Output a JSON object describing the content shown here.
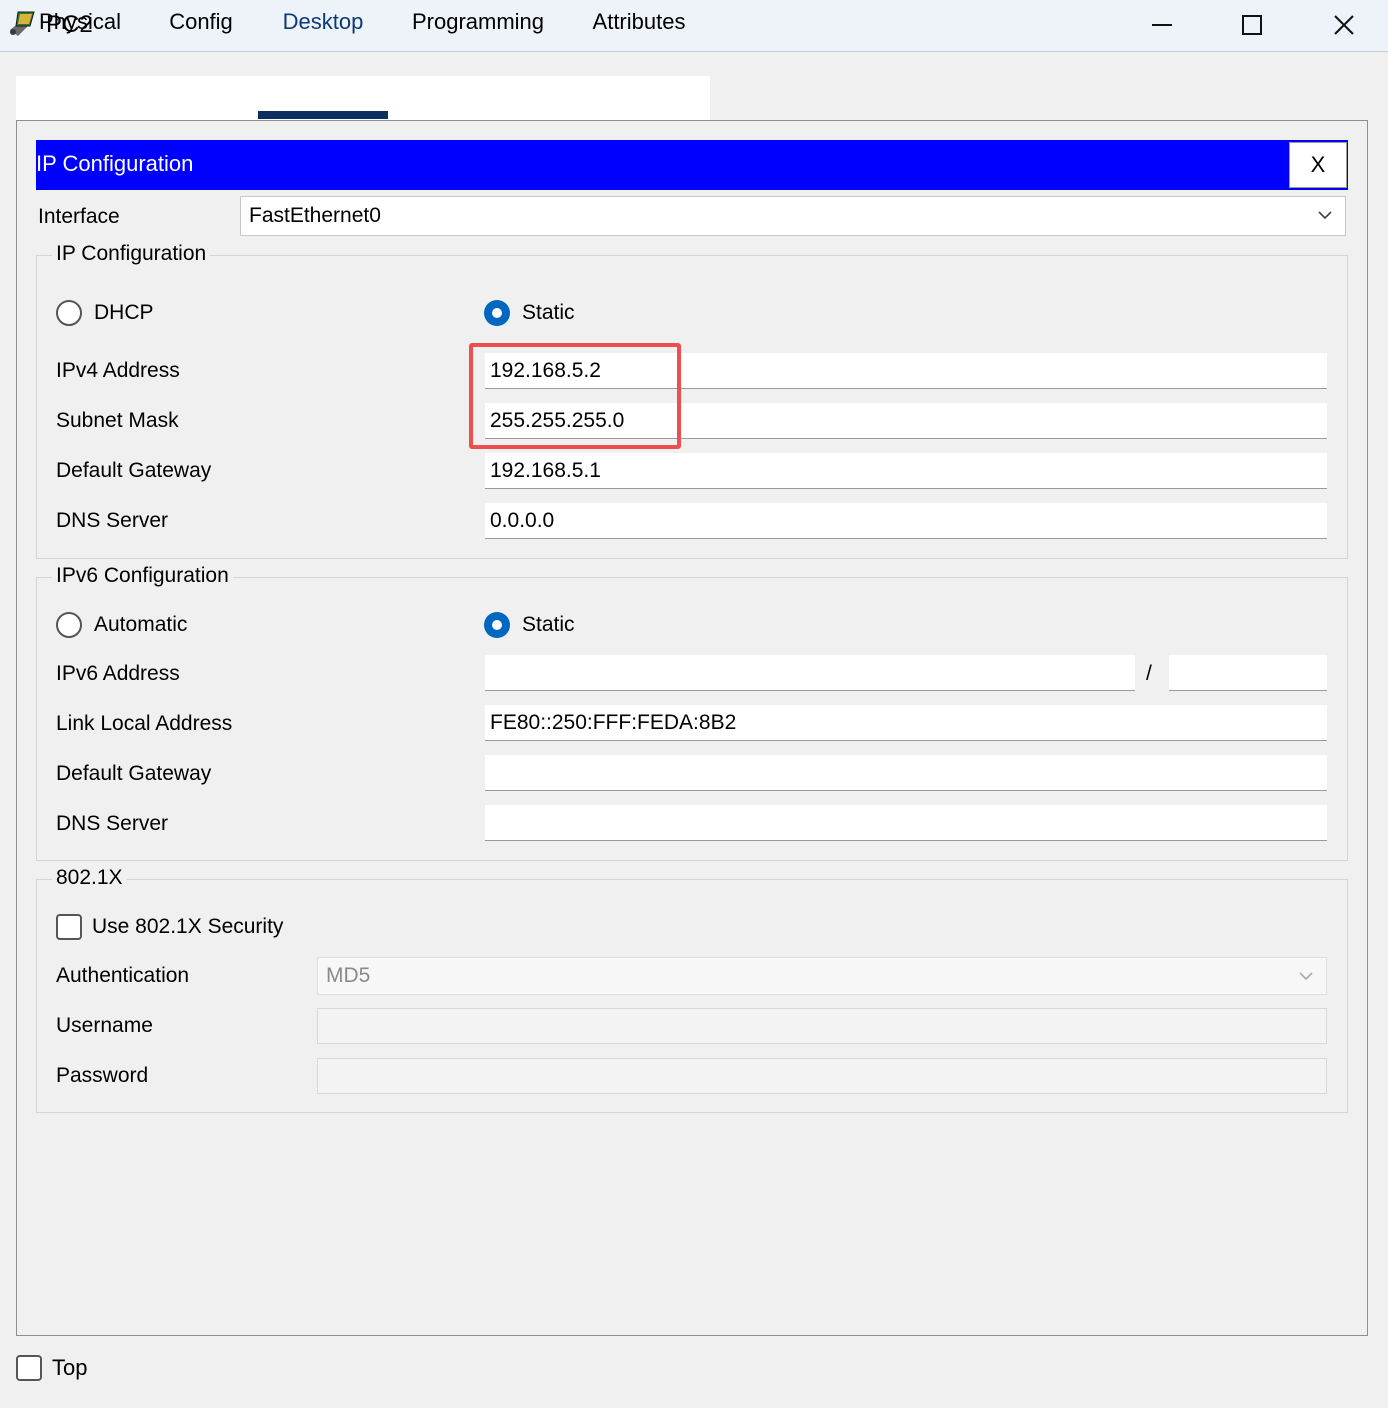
{
  "window": {
    "title": "PC2",
    "controls": {
      "minimize": "minimize",
      "maximize": "maximize",
      "close": "close"
    }
  },
  "tabs": [
    {
      "label": "Physical"
    },
    {
      "label": "Config"
    },
    {
      "label": "Desktop",
      "active": true
    },
    {
      "label": "Programming"
    },
    {
      "label": "Attributes"
    }
  ],
  "ip_config_panel": {
    "header": "IP Configuration",
    "close_label": "X",
    "interface_label": "Interface",
    "interface_value": "FastEthernet0",
    "ipv4": {
      "group_title": "IP Configuration",
      "dhcp_label": "DHCP",
      "static_label": "Static",
      "mode": "Static",
      "ipv4_address_label": "IPv4 Address",
      "ipv4_address": "192.168.5.2",
      "subnet_mask_label": "Subnet Mask",
      "subnet_mask": "255.255.255.0",
      "default_gateway_label": "Default Gateway",
      "default_gateway": "192.168.5.1",
      "dns_server_label": "DNS Server",
      "dns_server": "0.0.0.0"
    },
    "ipv6": {
      "group_title": "IPv6 Configuration",
      "automatic_label": "Automatic",
      "static_label": "Static",
      "mode": "Static",
      "ipv6_address_label": "IPv6 Address",
      "ipv6_address": "",
      "prefix_separator": "/",
      "prefix_length": "",
      "link_local_label": "Link Local Address",
      "link_local": "FE80::250:FFF:FEDA:8B2",
      "default_gateway_label": "Default Gateway",
      "default_gateway": "",
      "dns_server_label": "DNS Server",
      "dns_server": ""
    },
    "dot1x": {
      "group_title": "802.1X",
      "use_security_label": "Use 802.1X Security",
      "use_security": false,
      "authentication_label": "Authentication",
      "authentication_value": "MD5",
      "username_label": "Username",
      "username": "",
      "password_label": "Password",
      "password": ""
    }
  },
  "footer": {
    "top_label": "Top",
    "top_checked": false
  },
  "colors": {
    "header_blue": "#0000fe",
    "radio_blue": "#0067c0",
    "highlight_red": "#ec4f4f",
    "active_tab_underline": "#0b2f5e"
  },
  "icons": [
    "packet-tracer-pc-icon",
    "minimize-icon",
    "maximize-icon",
    "close-icon",
    "chevron-down-icon"
  ]
}
